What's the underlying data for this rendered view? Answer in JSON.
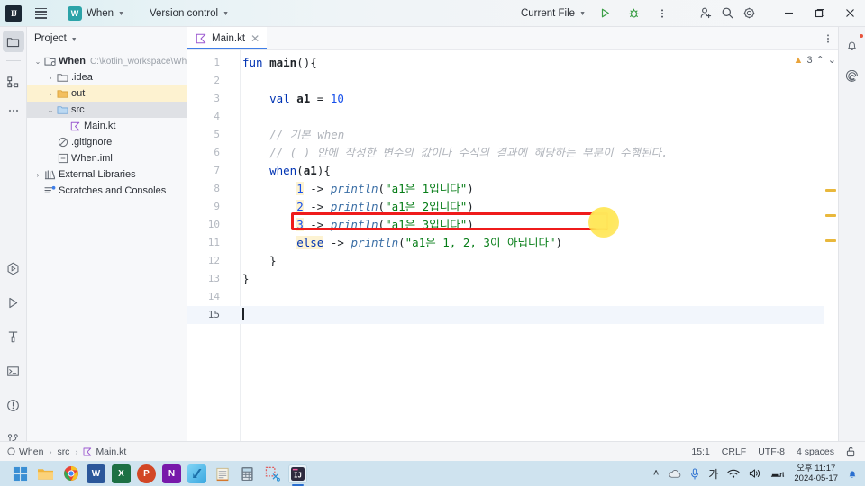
{
  "titlebar": {
    "logo": "IJ",
    "menu_icon": "hamburger-menu-icon",
    "project_badge": "W",
    "project_name": "When",
    "vcs_label": "Version control",
    "run_config": "Current File",
    "run_icon": "run-icon",
    "debug_icon": "debug-icon",
    "more_icon": "more-vertical-icon",
    "share_icon": "add-user-icon",
    "search_icon": "search-icon",
    "settings_icon": "gear-icon",
    "minimize": "–",
    "maximize": "❐",
    "close": "✕"
  },
  "left_rail": {
    "top": [
      "project-icon",
      "structure-icon",
      "more-dots-icon"
    ],
    "bottom": [
      "run-coverage-icon",
      "run-icon",
      "build-icon",
      "terminal-icon",
      "problems-icon",
      "git-branch-icon"
    ]
  },
  "right_rail": {
    "items": [
      "notifications-bell-icon",
      "ai-assistant-icon"
    ]
  },
  "project_panel": {
    "title": "Project",
    "tree": [
      {
        "label": "When",
        "path": "C:\\kotlin_workspace\\Whe",
        "icon": "module-icon",
        "indent": 0,
        "arrow": "⌄",
        "bold": true,
        "state": "normal"
      },
      {
        "label": ".idea",
        "path": "",
        "icon": "folder-icon",
        "indent": 1,
        "arrow": "›",
        "bold": false,
        "state": "normal"
      },
      {
        "label": "out",
        "path": "",
        "icon": "folder-orange-icon",
        "indent": 1,
        "arrow": "›",
        "bold": false,
        "state": "highlighted"
      },
      {
        "label": "src",
        "path": "",
        "icon": "folder-blue-icon",
        "indent": 1,
        "arrow": "⌄",
        "bold": false,
        "state": "selected"
      },
      {
        "label": "Main.kt",
        "path": "",
        "icon": "kotlin-file-icon",
        "indent": 2,
        "arrow": "",
        "bold": false,
        "state": "normal"
      },
      {
        "label": ".gitignore",
        "path": "",
        "icon": "gitignore-icon",
        "indent": 1,
        "arrow": "",
        "bold": false,
        "state": "normal"
      },
      {
        "label": "When.iml",
        "path": "",
        "icon": "iml-file-icon",
        "indent": 1,
        "arrow": "",
        "bold": false,
        "state": "normal"
      },
      {
        "label": "External Libraries",
        "path": "",
        "icon": "libraries-icon",
        "indent": 0,
        "arrow": "›",
        "bold": false,
        "state": "normal"
      },
      {
        "label": "Scratches and Consoles",
        "path": "",
        "icon": "scratches-icon",
        "indent": 0,
        "arrow": "",
        "bold": false,
        "state": "normal"
      }
    ]
  },
  "editor": {
    "tab": {
      "label": "Main.kt",
      "icon": "kotlin-file-icon",
      "close": "✕"
    },
    "tab_more_icon": "more-vertical-icon",
    "inspection": {
      "warn_icon": "warning-triangle-icon",
      "warn_count": "3",
      "up": "⌃",
      "down": "⌄"
    },
    "lines": [
      {
        "n": "1",
        "tokens": [
          {
            "t": "fun ",
            "c": "kw"
          },
          {
            "t": "main",
            "c": "ident-b"
          },
          {
            "t": "(){",
            "c": "plain"
          }
        ],
        "run_marker": true
      },
      {
        "n": "2",
        "tokens": []
      },
      {
        "n": "3",
        "tokens": [
          {
            "t": "    ",
            "c": "plain"
          },
          {
            "t": "val ",
            "c": "kw"
          },
          {
            "t": "a1",
            "c": "ident-b"
          },
          {
            "t": " = ",
            "c": "plain"
          },
          {
            "t": "10",
            "c": "num"
          }
        ]
      },
      {
        "n": "4",
        "tokens": []
      },
      {
        "n": "5",
        "tokens": [
          {
            "t": "    ",
            "c": "plain"
          },
          {
            "t": "// 기본 when",
            "c": "cmt"
          }
        ]
      },
      {
        "n": "6",
        "tokens": [
          {
            "t": "    ",
            "c": "plain"
          },
          {
            "t": "// ( ) 안에 작성한 변수의 값이나 수식의 결과에 해당하는 부분이 수행된다.",
            "c": "cmt"
          }
        ]
      },
      {
        "n": "7",
        "tokens": [
          {
            "t": "    ",
            "c": "plain"
          },
          {
            "t": "when",
            "c": "kw"
          },
          {
            "t": "(",
            "c": "plain"
          },
          {
            "t": "a1",
            "c": "ident-b"
          },
          {
            "t": "){",
            "c": "plain"
          }
        ]
      },
      {
        "n": "8",
        "tokens": [
          {
            "t": "        ",
            "c": "plain"
          },
          {
            "t": "1",
            "c": "num mark"
          },
          {
            "t": " -> ",
            "c": "plain"
          },
          {
            "t": "println",
            "c": "fn"
          },
          {
            "t": "(",
            "c": "plain"
          },
          {
            "t": "\"a1은 1입니다\"",
            "c": "str"
          },
          {
            "t": ")",
            "c": "plain"
          }
        ]
      },
      {
        "n": "9",
        "tokens": [
          {
            "t": "        ",
            "c": "plain"
          },
          {
            "t": "2",
            "c": "num mark"
          },
          {
            "t": " -> ",
            "c": "plain"
          },
          {
            "t": "println",
            "c": "fn"
          },
          {
            "t": "(",
            "c": "plain"
          },
          {
            "t": "\"a1은 2입니다\"",
            "c": "str"
          },
          {
            "t": ")",
            "c": "plain"
          }
        ]
      },
      {
        "n": "10",
        "tokens": [
          {
            "t": "        ",
            "c": "plain"
          },
          {
            "t": "3",
            "c": "num mark"
          },
          {
            "t": " -> ",
            "c": "plain"
          },
          {
            "t": "println",
            "c": "fn"
          },
          {
            "t": "(",
            "c": "plain"
          },
          {
            "t": "\"a1은 3입니다\"",
            "c": "str"
          },
          {
            "t": ")",
            "c": "plain"
          }
        ]
      },
      {
        "n": "11",
        "tokens": [
          {
            "t": "        ",
            "c": "plain"
          },
          {
            "t": "else",
            "c": "kw mark"
          },
          {
            "t": " -> ",
            "c": "plain"
          },
          {
            "t": "println",
            "c": "fn"
          },
          {
            "t": "(",
            "c": "plain"
          },
          {
            "t": "\"a1은 1, 2, 3이 아닙니다\"",
            "c": "str"
          },
          {
            "t": ")",
            "c": "plain"
          }
        ]
      },
      {
        "n": "12",
        "tokens": [
          {
            "t": "    }",
            "c": "plain"
          }
        ]
      },
      {
        "n": "13",
        "tokens": [
          {
            "t": "}",
            "c": "plain"
          }
        ]
      },
      {
        "n": "14",
        "tokens": []
      },
      {
        "n": "15",
        "tokens": [],
        "current": true,
        "caret": true
      }
    ],
    "annotations": {
      "highlight_box": "red-rectangle-annotation",
      "cursor_dot": "yellow-cursor-highlight"
    },
    "warning_markers": 3
  },
  "statusbar": {
    "breadcrumbs": [
      {
        "label": "When",
        "icon": "module-icon"
      },
      {
        "label": "src",
        "icon": ""
      },
      {
        "label": "Main.kt",
        "icon": "kotlin-file-icon"
      }
    ],
    "separator": "›",
    "caret_position": "15:1",
    "line_separator": "CRLF",
    "encoding": "UTF-8",
    "indent": "4 spaces",
    "lock_icon": "unlocked-icon"
  },
  "taskbar": {
    "apps": [
      {
        "name": "windows-start-icon",
        "label": ""
      },
      {
        "name": "file-explorer-icon",
        "label": ""
      },
      {
        "name": "chrome-icon",
        "label": ""
      },
      {
        "name": "word-icon",
        "label": "W"
      },
      {
        "name": "excel-icon",
        "label": "X"
      },
      {
        "name": "powerpoint-icon",
        "label": "P"
      },
      {
        "name": "onenote-icon",
        "label": "N"
      },
      {
        "name": "kakao-icon",
        "label": ""
      },
      {
        "name": "notepad-icon",
        "label": ""
      },
      {
        "name": "calculator-icon",
        "label": ""
      },
      {
        "name": "snipping-tool-icon",
        "label": ""
      },
      {
        "name": "intellij-idea-icon",
        "label": "IJ"
      }
    ],
    "tray": {
      "chevron": "˄",
      "cloud_icon": "onedrive-cloud-icon",
      "mic_icon": "microphone-icon",
      "ime": "가",
      "wifi_icon": "wifi-icon",
      "volume_icon": "speaker-icon",
      "network_icon": "network-icon",
      "time": "오후 11:17",
      "date": "2024-05-17",
      "notification_icon": "notification-bell-icon"
    }
  },
  "colors": {
    "accent": "#3f7ee8",
    "keyword": "#0033b3",
    "string": "#067d17",
    "comment": "#b0b4bb",
    "annotation_red": "#ef1b1b",
    "annotation_yellow": "#ffe24c",
    "warning": "#e9b83c"
  }
}
